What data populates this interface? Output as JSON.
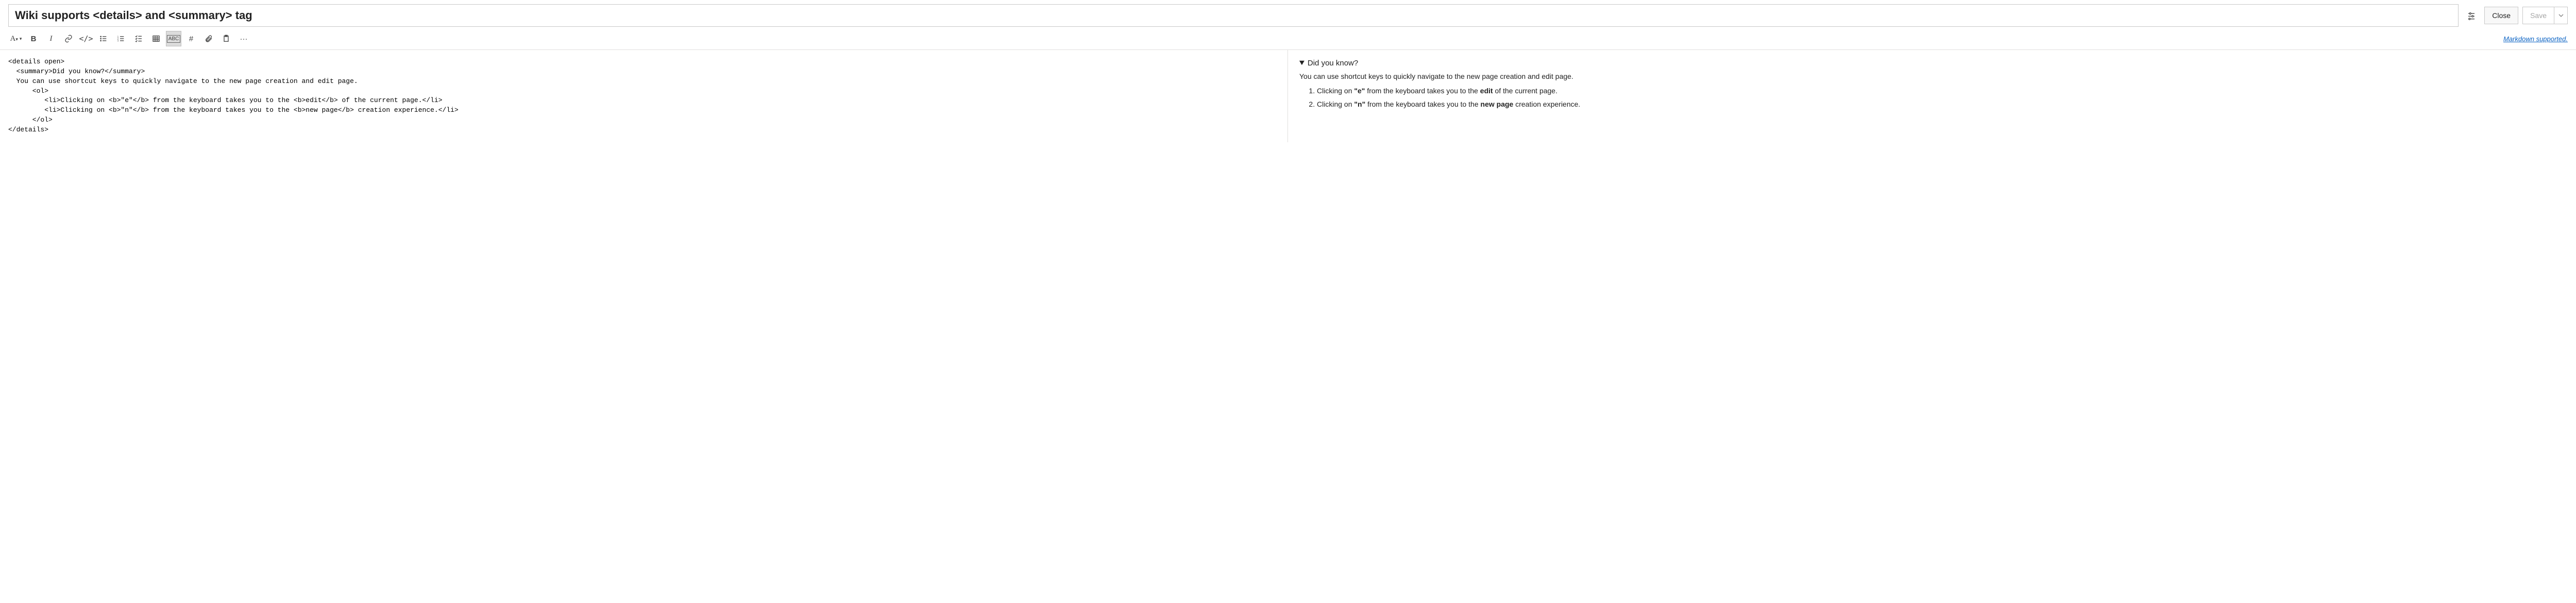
{
  "title": "Wiki supports <details> and <summary> tag",
  "header": {
    "close_label": "Close",
    "save_label": "Save"
  },
  "toolbar": {
    "markdown_link": "Markdown supported."
  },
  "editor": {
    "lines": [
      "<details open>",
      "  <summary>Did you know?</summary>",
      "  You can use shortcut keys to quickly navigate to the new page creation and edit page.",
      "      <ol>",
      "         <li>Clicking on <b>\"e\"</b> from the keyboard takes you to the <b>edit</b> of the current page.</li>",
      "         <li>Clicking on <b>\"n\"</b> from the keyboard takes you to the <b>new page</b> creation experience.</li>",
      "      </ol>",
      "</details>"
    ]
  },
  "preview": {
    "summary": "Did you know?",
    "body": "You can use shortcut keys to quickly navigate to the new page creation and edit page.",
    "li1_a": "Clicking on ",
    "li1_b": "\"e\"",
    "li1_c": " from the keyboard takes you to the ",
    "li1_d": "edit",
    "li1_e": " of the current page.",
    "li2_a": "Clicking on ",
    "li2_b": "\"n\"",
    "li2_c": " from the keyboard takes you to the ",
    "li2_d": "new page",
    "li2_e": " creation experience."
  }
}
